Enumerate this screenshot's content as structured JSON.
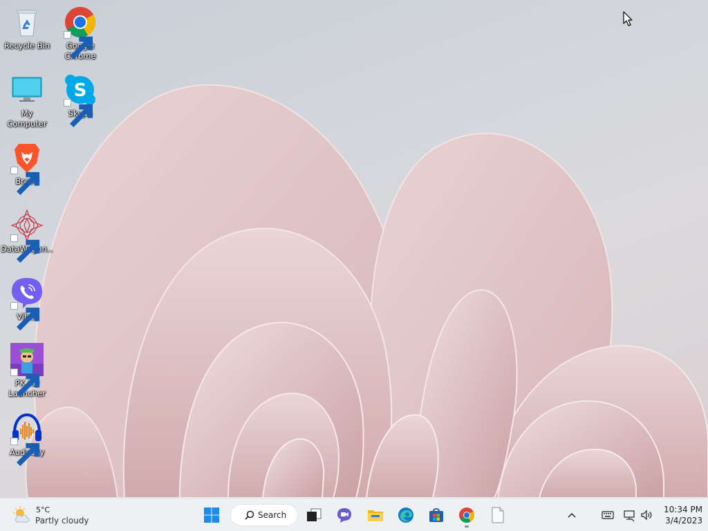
{
  "desktop": {
    "icons": [
      {
        "label": "Recycle Bin",
        "icon": "recycle-bin-icon"
      },
      {
        "label": "Google\nChrome",
        "icon": "chrome-icon"
      },
      {
        "label": "My Computer",
        "icon": "monitor-icon"
      },
      {
        "label": "Skype",
        "icon": "skype-icon"
      },
      {
        "label": "Brave",
        "icon": "brave-icon"
      },
      {
        "label": "DataWagon...",
        "icon": "datawagon-icon"
      },
      {
        "label": "Viber",
        "icon": "viber-icon"
      },
      {
        "label": "PK XD\nLauncher",
        "icon": "pk-xd-icon"
      },
      {
        "label": "Audacity",
        "icon": "audacity-icon"
      }
    ]
  },
  "taskbar": {
    "weather": {
      "temp": "5°C",
      "condition": "Partly cloudy"
    },
    "search_label": "Search",
    "pinned": [
      {
        "name": "start",
        "icon": "windows-logo-icon"
      },
      {
        "name": "task-view",
        "icon": "task-view-icon"
      },
      {
        "name": "chat",
        "icon": "teams-chat-icon"
      },
      {
        "name": "file-explorer",
        "icon": "folder-icon"
      },
      {
        "name": "edge",
        "icon": "edge-icon"
      },
      {
        "name": "store",
        "icon": "store-icon"
      },
      {
        "name": "chrome",
        "icon": "chrome-icon",
        "running": true
      },
      {
        "name": "notepad",
        "icon": "document-icon"
      }
    ],
    "clock": {
      "time": "10:34 PM",
      "date": "3/4/2023"
    }
  },
  "colors": {
    "taskbar_bg": "#eef1f4",
    "windows_blue": "#1a73e8",
    "petal": "#e4c7c9"
  }
}
